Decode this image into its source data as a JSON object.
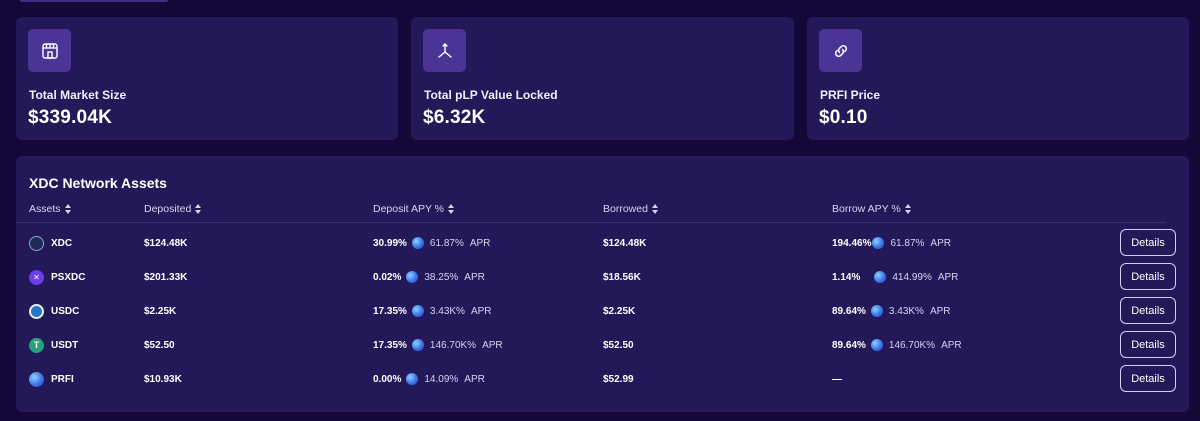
{
  "stats": [
    {
      "label": "Total Market Size",
      "value": "$339.04K",
      "icon": "store-icon"
    },
    {
      "label": "Total pLP Value Locked",
      "value": "$6.32K",
      "icon": "split-arrows-icon"
    },
    {
      "label": "PRFI Price",
      "value": "$0.10",
      "icon": "link-icon"
    }
  ],
  "assets": {
    "title": "XDC Network Assets",
    "columns": [
      "Assets",
      "Deposited",
      "Deposit APY %",
      "Borrowed",
      "Borrow APY %"
    ],
    "apr_word": "APR",
    "details_label": "Details",
    "rows": [
      {
        "asset": "XDC",
        "deposited": "$124.48K",
        "deposit_apy": "30.99%",
        "deposit_apr": "61.87%",
        "borrowed": "$124.48K",
        "borrow_apy": "194.46%",
        "borrow_apr": "61.87%",
        "icon": "xdc-coin-icon"
      },
      {
        "asset": "PSXDC",
        "deposited": "$201.33K",
        "deposit_apy": "0.02%",
        "deposit_apr": "38.25%",
        "borrowed": "$18.56K",
        "borrow_apy": "1.14%",
        "borrow_apr": "414.99%",
        "icon": "psxdc-coin-icon"
      },
      {
        "asset": "USDC",
        "deposited": "$2.25K",
        "deposit_apy": "17.35%",
        "deposit_apr": "3.43K%",
        "borrowed": "$2.25K",
        "borrow_apy": "89.64%",
        "borrow_apr": "3.43K%",
        "icon": "usdc-coin-icon"
      },
      {
        "asset": "USDT",
        "deposited": "$52.50",
        "deposit_apy": "17.35%",
        "deposit_apr": "146.70K%",
        "borrowed": "$52.50",
        "borrow_apy": "89.64%",
        "borrow_apr": "146.70K%",
        "icon": "usdt-coin-icon"
      },
      {
        "asset": "PRFI",
        "deposited": "$10.93K",
        "deposit_apy": "0.00%",
        "deposit_apr": "14.09%",
        "borrowed": "$52.99",
        "borrow_apy": "—",
        "borrow_apr": null,
        "icon": "prfi-coin-icon"
      }
    ]
  },
  "colors": {
    "background": "#130838",
    "card": "#241958",
    "icon_box": "#4a3597"
  }
}
